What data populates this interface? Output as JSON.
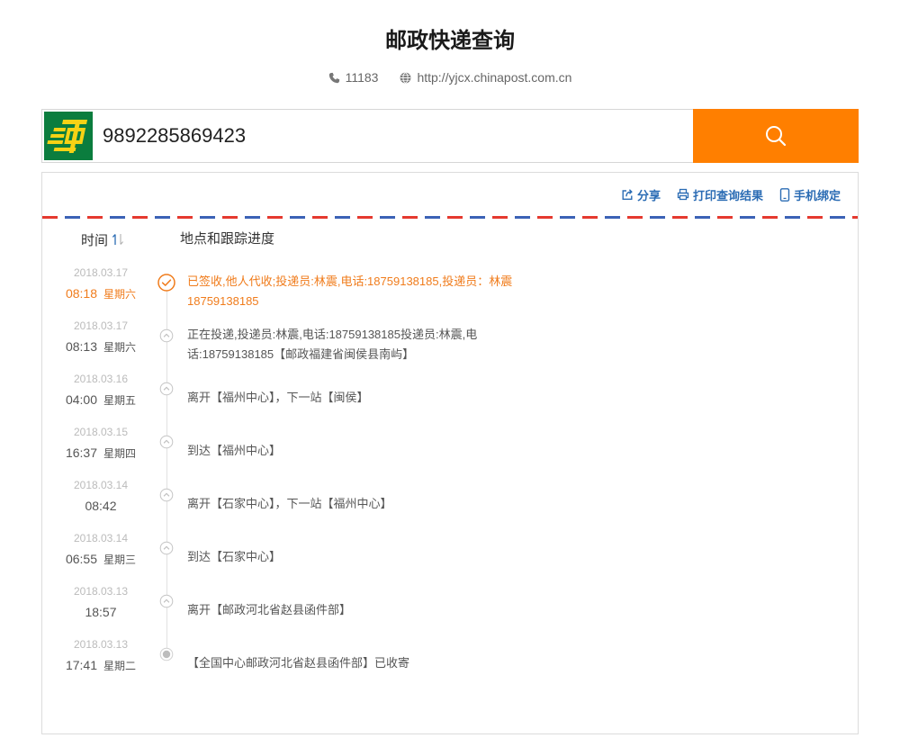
{
  "header": {
    "title": "邮政快递查询",
    "phone_icon": "phone-icon",
    "phone": "11183",
    "website_icon": "globe-icon",
    "website": "http://yjcx.chinapost.com.cn"
  },
  "search": {
    "logo": "china-post-logo",
    "query": "9892285869423",
    "button_icon": "search-icon"
  },
  "actions": {
    "share": {
      "icon": "share-icon",
      "label": "分享"
    },
    "print": {
      "icon": "print-icon",
      "label": "打印查询结果"
    },
    "bind_phone": {
      "icon": "mobile-phone-icon",
      "label": "手机绑定"
    }
  },
  "table": {
    "time_header": "时间",
    "sort_icon": "sort-arrows-icon",
    "progress_header": "地点和跟踪进度"
  },
  "events": [
    {
      "date": "2018.03.17",
      "time": "08:18",
      "weekday": "星期六",
      "icon": "check-circle-icon",
      "highlight": true,
      "text": "已签收,他人代收;投递员:林震,电话:18759138185,投递员：林震18759138185"
    },
    {
      "date": "2018.03.17",
      "time": "08:13",
      "weekday": "星期六",
      "icon": "chevron-up-circle-icon",
      "text": "正在投递,投递员:林震,电话:18759138185投递员:林震,电话:18759138185【邮政福建省闽侯县南屿】"
    },
    {
      "date": "2018.03.16",
      "time": "04:00",
      "weekday": "星期五",
      "icon": "chevron-up-circle-icon",
      "text": "离开【福州中心】，下一站【闽侯】"
    },
    {
      "date": "2018.03.15",
      "time": "16:37",
      "weekday": "星期四",
      "icon": "chevron-up-circle-icon",
      "text": "到达【福州中心】"
    },
    {
      "date": "2018.03.14",
      "time": "08:42",
      "icon": "chevron-up-circle-icon",
      "text": "离开【石家中心】，下一站【福州中心】"
    },
    {
      "date": "2018.03.14",
      "time": "06:55",
      "weekday": "星期三",
      "icon": "chevron-up-circle-icon",
      "text": "到达【石家中心】"
    },
    {
      "date": "2018.03.13",
      "time": "18:57",
      "icon": "chevron-up-circle-icon",
      "text": "离开【邮政河北省赵县函件部】"
    },
    {
      "date": "2018.03.13",
      "time": "17:41",
      "weekday": "星期二",
      "icon": "dot-circle-icon",
      "text": "【全国中心邮政河北省赵县函件部】已收寄"
    }
  ],
  "theme": {
    "accent": "#ff7f00",
    "highlight": "#f07c1c",
    "link": "#2b6cb4",
    "stripe_red": "#e5392f",
    "stripe_blue": "#3b62b6",
    "logo_green": "#0b7d3e",
    "logo_yellow": "#f6d215"
  }
}
